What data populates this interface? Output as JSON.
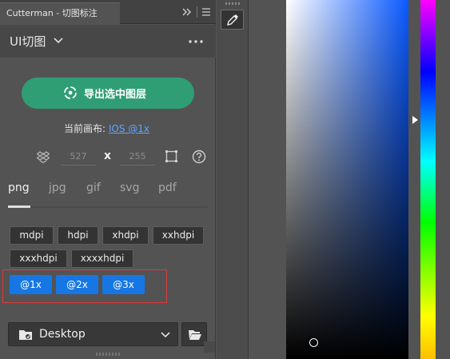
{
  "panel": {
    "tab_title": "Cutterman - 切图标注",
    "header_title": "UI切图",
    "export_button": "导出选中图层",
    "canvas_label": "当前画布: ",
    "canvas_value": "IOS @1x",
    "width_value": "527",
    "height_value": "255",
    "times": "x"
  },
  "formats": [
    "png",
    "jpg",
    "gif",
    "svg",
    "pdf"
  ],
  "active_format": "png",
  "densities": [
    "mdpi",
    "hdpi",
    "xhdpi",
    "xxhdpi",
    "xxxhdpi",
    "xxxxhdpi"
  ],
  "scales": [
    "@1x",
    "@2x",
    "@3x"
  ],
  "output_folder": "Desktop",
  "colors": {
    "accent_green": "#2f9e74",
    "scale_blue": "#1677e4",
    "highlight_red": "#e0393e",
    "link_blue": "#5ea4ff",
    "picker_base": "#0a59ff"
  },
  "icons": [
    "collapse-icon",
    "menu-icon",
    "chevron-down-icon",
    "more-icon",
    "target-icon",
    "dropbox-icon",
    "frame-icon",
    "help-icon",
    "folder-icon",
    "folder-open-icon",
    "eyedropper-icon"
  ]
}
